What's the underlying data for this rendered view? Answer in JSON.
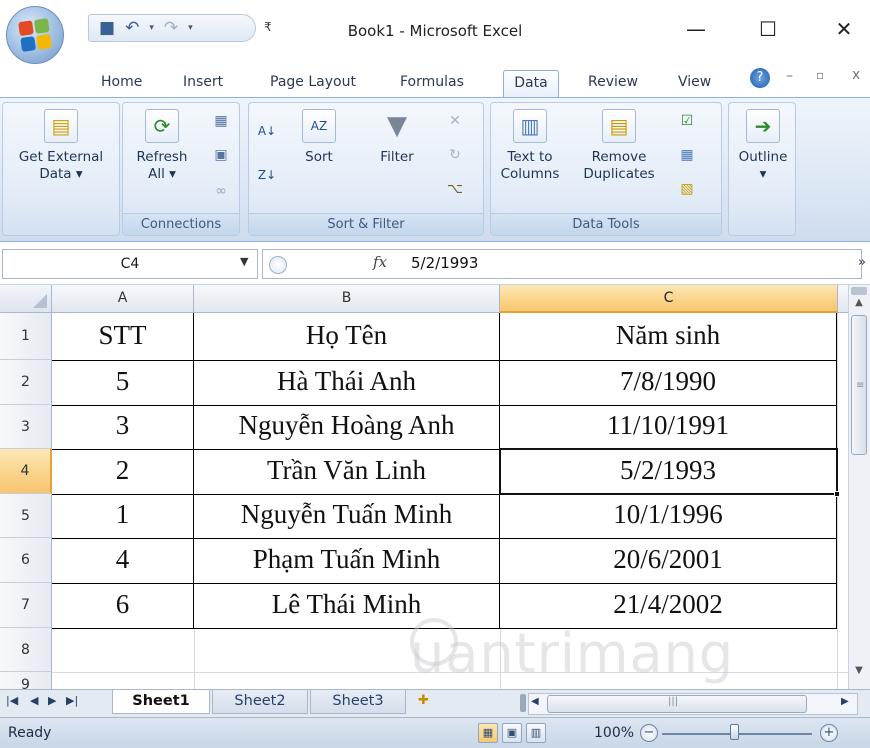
{
  "window": {
    "title": "Book1 - Microsoft Excel",
    "minimize_icon": "—",
    "maximize_icon": "☐",
    "close_icon": "✕"
  },
  "ribbon_tabs": [
    {
      "label": "Home"
    },
    {
      "label": "Insert"
    },
    {
      "label": "Page Layout"
    },
    {
      "label": "Formulas"
    },
    {
      "label": "Data",
      "active": true
    },
    {
      "label": "Review"
    },
    {
      "label": "View"
    }
  ],
  "ribbon": {
    "get_external_data": {
      "line1": "Get External",
      "line2": "Data ▾"
    },
    "refresh": {
      "line1": "Refresh",
      "line2": "All ▾"
    },
    "sort_az": "A↓Z",
    "sort": "Sort",
    "filter": "Filter",
    "text_to_columns": {
      "line1": "Text to",
      "line2": "Columns"
    },
    "remove_duplicates": {
      "line1": "Remove",
      "line2": "Duplicates"
    },
    "outline": {
      "line1": "Outline",
      "line2": "▾"
    },
    "groups": {
      "connections": "Connections",
      "sort_filter": "Sort & Filter",
      "data_tools": "Data Tools"
    }
  },
  "formula_bar": {
    "name_box": "C4",
    "fx": "fx",
    "value": "5/2/1993"
  },
  "columns": [
    "A",
    "B",
    "C"
  ],
  "selected_column": "C",
  "selected_row": 4,
  "rows": [
    {
      "num": "1",
      "a": "STT",
      "b": "Họ Tên",
      "c": "Năm sinh"
    },
    {
      "num": "2",
      "a": "5",
      "b": "Hà Thái Anh",
      "c": "7/8/1990"
    },
    {
      "num": "3",
      "a": "3",
      "b": "Nguyễn Hoàng Anh",
      "c": "11/10/1991"
    },
    {
      "num": "4",
      "a": "2",
      "b": "Trần Văn Linh",
      "c": "5/2/1993"
    },
    {
      "num": "5",
      "a": "1",
      "b": "Nguyễn Tuấn Minh",
      "c": "10/1/1996"
    },
    {
      "num": "6",
      "a": "4",
      "b": "Phạm Tuấn Minh",
      "c": "20/6/2001"
    },
    {
      "num": "7",
      "a": "6",
      "b": "Lê Thái Minh",
      "c": "21/4/2002"
    },
    {
      "num": "8",
      "a": "",
      "b": "",
      "c": ""
    },
    {
      "num": "9",
      "a": "",
      "b": "",
      "c": ""
    }
  ],
  "sheets": [
    {
      "label": "Sheet1",
      "active": true
    },
    {
      "label": "Sheet2"
    },
    {
      "label": "Sheet3"
    }
  ],
  "status": {
    "text": "Ready",
    "zoom": "100%"
  },
  "watermark": "uantrimang",
  "colors": {
    "accent_selection": "#f7c56d",
    "ribbon_blue": "#dde8f5",
    "excel_green": "#1e7145"
  }
}
